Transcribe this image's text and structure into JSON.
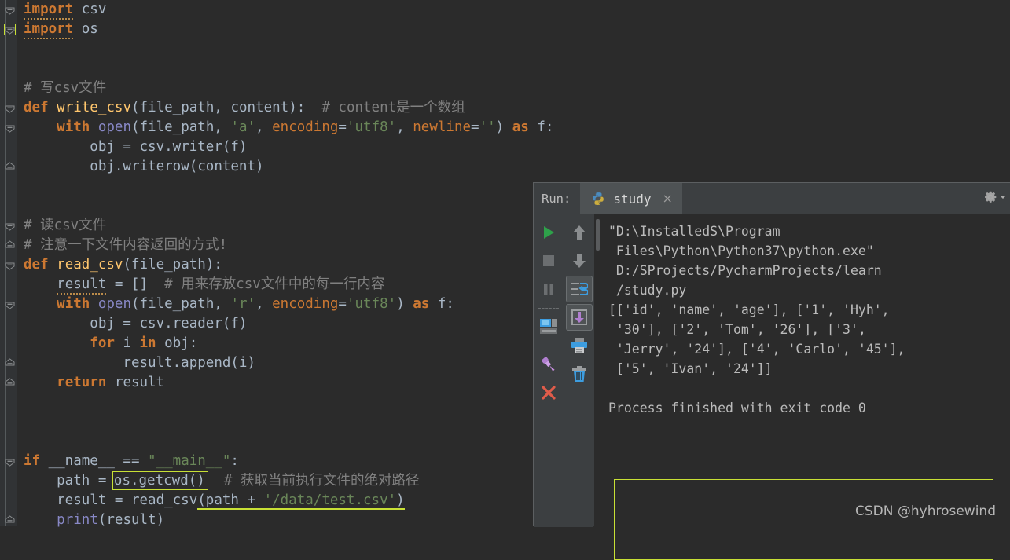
{
  "editor": {
    "background": "#2b2b2b",
    "gutter_background": "#313335",
    "lines": [
      {
        "n": 1,
        "fold": "collapse",
        "segs": [
          {
            "t": "import",
            "c": "kw",
            "squiggle": true
          },
          {
            "t": " csv",
            "c": "pl"
          }
        ]
      },
      {
        "n": 2,
        "fold": "collapse-sel",
        "box": true,
        "segs": [
          {
            "t": "import",
            "c": "kw",
            "squiggle": true
          },
          {
            "t": " os",
            "c": "pl"
          }
        ]
      },
      {
        "n": 3,
        "segs": []
      },
      {
        "n": 4,
        "segs": []
      },
      {
        "n": 5,
        "segs": [
          {
            "t": "# 写csv文件",
            "c": "cmt"
          }
        ]
      },
      {
        "n": 6,
        "fold": "collapse",
        "segs": [
          {
            "t": "def ",
            "c": "kw"
          },
          {
            "t": "write_csv",
            "c": "fn"
          },
          {
            "t": "(",
            "c": "pl"
          },
          {
            "t": "file_path, content",
            "c": "param"
          },
          {
            "t": "):  ",
            "c": "pl"
          },
          {
            "t": "# content是一个数组",
            "c": "cmt"
          }
        ]
      },
      {
        "n": 7,
        "fold": "collapse",
        "segs": [
          {
            "t": "    ",
            "c": "pl"
          },
          {
            "t": "with ",
            "c": "kw"
          },
          {
            "t": "open",
            "c": "bi"
          },
          {
            "t": "(file_path, ",
            "c": "pl"
          },
          {
            "t": "'a'",
            "c": "str"
          },
          {
            "t": ", ",
            "c": "pl"
          },
          {
            "t": "encoding",
            "c": "kwarg"
          },
          {
            "t": "=",
            "c": "pl"
          },
          {
            "t": "'utf8'",
            "c": "str"
          },
          {
            "t": ", ",
            "c": "pl"
          },
          {
            "t": "newline",
            "c": "kwarg"
          },
          {
            "t": "=",
            "c": "pl"
          },
          {
            "t": "''",
            "c": "str"
          },
          {
            "t": ") ",
            "c": "pl"
          },
          {
            "t": "as",
            "c": "kw"
          },
          {
            "t": " f:",
            "c": "pl"
          }
        ]
      },
      {
        "n": 8,
        "segs": [
          {
            "t": "        obj = csv.writer(f)",
            "c": "pl"
          }
        ]
      },
      {
        "n": 9,
        "fold": "expand",
        "segs": [
          {
            "t": "        obj.writerow(content)",
            "c": "pl"
          }
        ]
      },
      {
        "n": 10,
        "segs": []
      },
      {
        "n": 11,
        "segs": []
      },
      {
        "n": 12,
        "fold": "collapse",
        "segs": [
          {
            "t": "# 读csv文件",
            "c": "cmt"
          }
        ]
      },
      {
        "n": 13,
        "fold": "expand",
        "segs": [
          {
            "t": "# 注意一下文件内容返回的方式!",
            "c": "cmt"
          }
        ]
      },
      {
        "n": 14,
        "fold": "collapse",
        "segs": [
          {
            "t": "def ",
            "c": "kw"
          },
          {
            "t": "read_csv",
            "c": "fn"
          },
          {
            "t": "(",
            "c": "pl"
          },
          {
            "t": "file_path",
            "c": "param"
          },
          {
            "t": "):",
            "c": "pl"
          }
        ]
      },
      {
        "n": 15,
        "segs": [
          {
            "t": "    ",
            "c": "pl"
          },
          {
            "t": "result",
            "c": "pl",
            "squiggle": true
          },
          {
            "t": " = []  ",
            "c": "pl"
          },
          {
            "t": "# 用来存放csv文件中的每一行内容",
            "c": "cmt"
          }
        ]
      },
      {
        "n": 16,
        "fold": "collapse",
        "segs": [
          {
            "t": "    ",
            "c": "pl"
          },
          {
            "t": "with ",
            "c": "kw"
          },
          {
            "t": "open",
            "c": "bi"
          },
          {
            "t": "(file_path, ",
            "c": "pl"
          },
          {
            "t": "'r'",
            "c": "str"
          },
          {
            "t": ", ",
            "c": "pl"
          },
          {
            "t": "encoding",
            "c": "kwarg"
          },
          {
            "t": "=",
            "c": "pl"
          },
          {
            "t": "'utf8'",
            "c": "str"
          },
          {
            "t": ") ",
            "c": "pl"
          },
          {
            "t": "as",
            "c": "kw"
          },
          {
            "t": " f:",
            "c": "pl"
          }
        ]
      },
      {
        "n": 17,
        "segs": [
          {
            "t": "        obj = csv.reader(f)",
            "c": "pl"
          }
        ]
      },
      {
        "n": 18,
        "segs": [
          {
            "t": "        ",
            "c": "pl"
          },
          {
            "t": "for",
            "c": "kw"
          },
          {
            "t": " i ",
            "c": "pl"
          },
          {
            "t": "in",
            "c": "kw"
          },
          {
            "t": " obj:",
            "c": "pl"
          }
        ]
      },
      {
        "n": 19,
        "fold": "expand",
        "segs": [
          {
            "t": "            result.append(i)",
            "c": "pl"
          }
        ]
      },
      {
        "n": 20,
        "fold": "expand",
        "segs": [
          {
            "t": "    ",
            "c": "pl"
          },
          {
            "t": "return",
            "c": "kw"
          },
          {
            "t": " result",
            "c": "pl"
          }
        ]
      },
      {
        "n": 21,
        "segs": []
      },
      {
        "n": 22,
        "segs": []
      },
      {
        "n": 23,
        "segs": []
      },
      {
        "n": 24,
        "fold": "collapse",
        "segs": [
          {
            "t": "if",
            "c": "kw"
          },
          {
            "t": " __name__ == ",
            "c": "pl"
          },
          {
            "t": "\"__main__\"",
            "c": "str"
          },
          {
            "t": ":",
            "c": "pl"
          }
        ]
      },
      {
        "n": 25,
        "segs": [
          {
            "t": "    path = ",
            "c": "pl"
          },
          {
            "t": "os.getcwd()",
            "c": "pl",
            "box": true
          },
          {
            "t": "  ",
            "c": "pl"
          },
          {
            "t": "# 获取当前执行文件的绝对路径",
            "c": "cmt"
          }
        ]
      },
      {
        "n": 26,
        "segs": [
          {
            "t": "    result = read_csv",
            "c": "pl"
          },
          {
            "t": "(path + ",
            "c": "pl",
            "uline": true
          },
          {
            "t": "'/data/test.csv'",
            "c": "str",
            "uline": true
          },
          {
            "t": ")",
            "c": "pl",
            "uline": true
          }
        ]
      },
      {
        "n": 27,
        "fold": "expand",
        "segs": [
          {
            "t": "    ",
            "c": "pl"
          },
          {
            "t": "print",
            "c": "bi"
          },
          {
            "t": "(result)",
            "c": "pl"
          }
        ]
      }
    ]
  },
  "run_window": {
    "label": "Run:",
    "tab": {
      "name": "study",
      "icon": "python-icon",
      "close": "×"
    },
    "gear": "settings-gear-icon",
    "toolbar_left": [
      {
        "name": "rerun-button",
        "icon": "play-icon"
      },
      {
        "name": "stop-button",
        "icon": "stop-icon"
      },
      {
        "name": "pause-button",
        "icon": "pause-icon"
      },
      {
        "name": "restore-layout-button",
        "icon": "restore-layout-icon"
      },
      {
        "name": "pin-tab-button",
        "icon": "pin-icon"
      },
      {
        "name": "close-button",
        "icon": "close-x-icon"
      }
    ],
    "toolbar_right": [
      {
        "name": "up-stack-trace-button",
        "icon": "arrow-up-icon"
      },
      {
        "name": "down-stack-trace-button",
        "icon": "arrow-down-icon"
      },
      {
        "name": "soft-wrap-button",
        "icon": "soft-wrap-icon",
        "selected": true
      },
      {
        "name": "scroll-to-end-button",
        "icon": "scroll-to-end-icon",
        "selected": true
      },
      {
        "name": "print-button",
        "icon": "printer-icon"
      },
      {
        "name": "clear-all-button",
        "icon": "trash-icon"
      }
    ],
    "console_lines": [
      "\"D:\\InstalledS\\Program",
      " Files\\Python\\Python37\\python.exe\"",
      " D:/SProjects/PycharmProjects/learn",
      " /study.py",
      "[['id', 'name', 'age'], ['1', 'Hyh',",
      " '30'], ['2', 'Tom', '26'], ['3',",
      " 'Jerry', '24'], ['4', 'Carlo', '45'],",
      " ['5', 'Ivan', '24']]",
      "",
      "Process finished with exit code 0"
    ],
    "highlight_color": "#c8e035"
  },
  "watermark": {
    "text": "CSDN @hyhrosewind"
  }
}
